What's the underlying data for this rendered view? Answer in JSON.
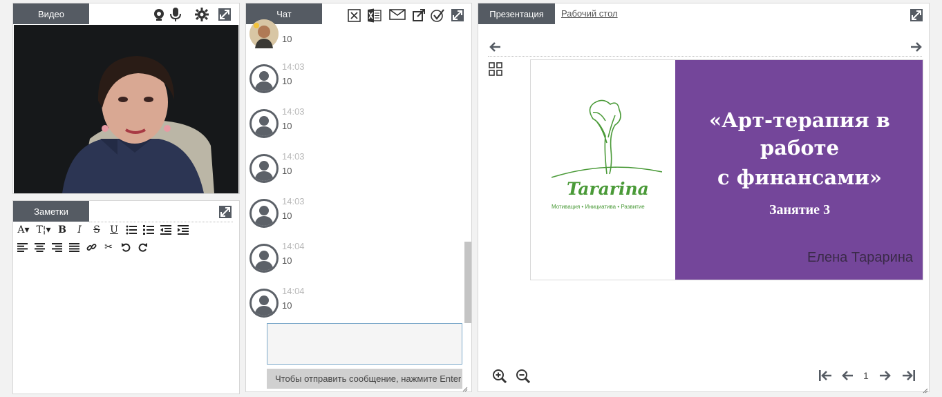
{
  "video": {
    "tab_label": "Видео"
  },
  "notes": {
    "tab_label": "Заметки",
    "content": ""
  },
  "chat": {
    "tab_label": "Чат",
    "messages": [
      {
        "time": "",
        "text": "10"
      },
      {
        "time": "14:03",
        "text": "10"
      },
      {
        "time": "14:03",
        "text": "10"
      },
      {
        "time": "14:03",
        "text": "10"
      },
      {
        "time": "14:03",
        "text": "10"
      },
      {
        "time": "14:04",
        "text": "10"
      },
      {
        "time": "14:04",
        "text": "10"
      }
    ],
    "input_value": "",
    "send_hint": "Чтобы отправить сообщение, нажмите Enter"
  },
  "presentation": {
    "tab_label": "Презентация",
    "desktop_tab_label": "Рабочий стол",
    "slide": {
      "brand": "Tararina",
      "brand_tagline": "Мотивация • Инициатива • Развитие",
      "title_line1": "«Арт-терапия в",
      "title_line2": "работе",
      "title_line3": "с финансами»",
      "subtitle": "Занятие 3",
      "author": "Елена Тарарина"
    },
    "page_number": "1"
  },
  "colors": {
    "tab_bg": "#555b63",
    "slide_purple": "#74469a",
    "brand_green": "#4a9a38",
    "input_border": "#7aa8c9"
  }
}
